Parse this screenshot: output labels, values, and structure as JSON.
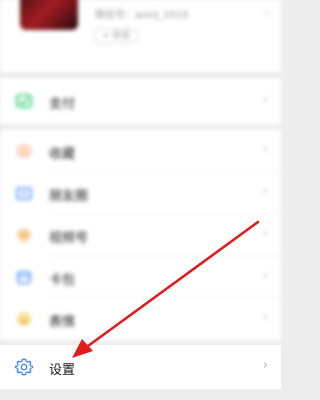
{
  "profile": {
    "wechat_id": "微信号：wxid_2019",
    "status": "+ 状态"
  },
  "groups": [
    {
      "items": [
        {
          "label": "支付",
          "icon": "pay-icon",
          "color": "#07c160"
        }
      ]
    },
    {
      "items": [
        {
          "label": "收藏",
          "icon": "favorites-icon",
          "color": "#f5a623"
        },
        {
          "label": "朋友圈",
          "icon": "moments-icon",
          "color": "#3b86f7"
        },
        {
          "label": "视频号",
          "icon": "channels-icon",
          "color": "#f2a23a"
        },
        {
          "label": "卡包",
          "icon": "cards-icon",
          "color": "#3b86f7"
        },
        {
          "label": "表情",
          "icon": "stickers-icon",
          "color": "#f5c33b"
        }
      ]
    }
  ],
  "settings": {
    "label": "设置",
    "icon": "gear-icon",
    "color": "#3b86f7"
  },
  "annotation": {
    "arrow_color": "#e01c1c"
  }
}
